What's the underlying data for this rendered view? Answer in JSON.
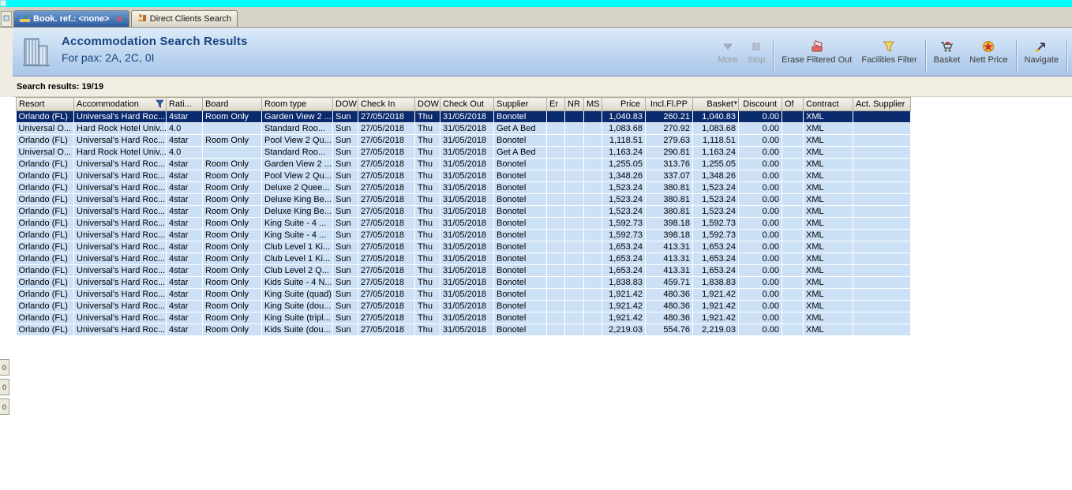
{
  "tabs": [
    {
      "label": "Book. ref.: <none>",
      "active": true,
      "icon": "beach-icon",
      "closable": true
    },
    {
      "label": "Direct Clients Search",
      "active": false,
      "icon": "clients-icon"
    }
  ],
  "header": {
    "title": "Accommodation Search Results",
    "subtitle": "For pax: 2A, 2C, 0I"
  },
  "toolbar": {
    "buttons": [
      {
        "label": "More",
        "icon": "more-icon",
        "disabled": true
      },
      {
        "label": "Stop",
        "icon": "stop-icon",
        "disabled": true
      },
      {
        "label": "Erase Filtered Out",
        "icon": "erase-filtered-out-icon",
        "disabled": false
      },
      {
        "label": "Facilities Filter",
        "icon": "facilities-filter-icon",
        "disabled": false
      },
      {
        "label": "Basket",
        "icon": "basket-icon",
        "disabled": false
      },
      {
        "label": "Nett Price",
        "icon": "nett-price-icon",
        "disabled": false
      },
      {
        "label": "Navigate",
        "icon": "navigate-icon",
        "disabled": false
      }
    ]
  },
  "results": {
    "summary": "Search results: 19/19"
  },
  "table": {
    "columns": [
      "Resort",
      "Accommodation",
      "Rati...",
      "Board",
      "Room type",
      "DOW",
      "Check In",
      "DOW",
      "Check Out",
      "Supplier",
      "Er",
      "NR",
      "MS",
      "Price",
      "Incl.Fl.PP",
      "Basket",
      "Discount",
      "Of",
      "Contract",
      "Act. Supplier"
    ],
    "selected_row_index": 0,
    "rows": [
      [
        "Orlando (FL)",
        "Universal's Hard Roc...",
        "4star",
        "Room Only",
        "Garden View 2 ...",
        "Sun",
        "27/05/2018",
        "Thu",
        "31/05/2018",
        "Bonotel",
        "",
        "",
        "",
        "1,040.83",
        "260.21",
        "1,040.83",
        "0.00",
        "",
        "XML",
        ""
      ],
      [
        "Universal O...",
        "Hard Rock Hotel Univ...",
        "4.0",
        "",
        "Standard Roo...",
        "Sun",
        "27/05/2018",
        "Thu",
        "31/05/2018",
        "Get A Bed",
        "",
        "",
        "",
        "1,083.68",
        "270.92",
        "1,083.68",
        "0.00",
        "",
        "XML",
        ""
      ],
      [
        "Orlando (FL)",
        "Universal's Hard Roc...",
        "4star",
        "Room Only",
        "Pool View 2 Qu...",
        "Sun",
        "27/05/2018",
        "Thu",
        "31/05/2018",
        "Bonotel",
        "",
        "",
        "",
        "1,118.51",
        "279.63",
        "1,118.51",
        "0.00",
        "",
        "XML",
        ""
      ],
      [
        "Universal O...",
        "Hard Rock Hotel Univ...",
        "4.0",
        "",
        "Standard Roo...",
        "Sun",
        "27/05/2018",
        "Thu",
        "31/05/2018",
        "Get A Bed",
        "",
        "",
        "",
        "1,163.24",
        "290.81",
        "1,163.24",
        "0.00",
        "",
        "XML",
        ""
      ],
      [
        "Orlando (FL)",
        "Universal's Hard Roc...",
        "4star",
        "Room Only",
        "Garden View 2 ...",
        "Sun",
        "27/05/2018",
        "Thu",
        "31/05/2018",
        "Bonotel",
        "",
        "",
        "",
        "1,255.05",
        "313.76",
        "1,255.05",
        "0.00",
        "",
        "XML",
        ""
      ],
      [
        "Orlando (FL)",
        "Universal's Hard Roc...",
        "4star",
        "Room Only",
        "Pool View 2 Qu...",
        "Sun",
        "27/05/2018",
        "Thu",
        "31/05/2018",
        "Bonotel",
        "",
        "",
        "",
        "1,348.26",
        "337.07",
        "1,348.26",
        "0.00",
        "",
        "XML",
        ""
      ],
      [
        "Orlando (FL)",
        "Universal's Hard Roc...",
        "4star",
        "Room Only",
        "Deluxe 2 Quee...",
        "Sun",
        "27/05/2018",
        "Thu",
        "31/05/2018",
        "Bonotel",
        "",
        "",
        "",
        "1,523.24",
        "380.81",
        "1,523.24",
        "0.00",
        "",
        "XML",
        ""
      ],
      [
        "Orlando (FL)",
        "Universal's Hard Roc...",
        "4star",
        "Room Only",
        "Deluxe King Be...",
        "Sun",
        "27/05/2018",
        "Thu",
        "31/05/2018",
        "Bonotel",
        "",
        "",
        "",
        "1,523.24",
        "380.81",
        "1,523.24",
        "0.00",
        "",
        "XML",
        ""
      ],
      [
        "Orlando (FL)",
        "Universal's Hard Roc...",
        "4star",
        "Room Only",
        "Deluxe King Be...",
        "Sun",
        "27/05/2018",
        "Thu",
        "31/05/2018",
        "Bonotel",
        "",
        "",
        "",
        "1,523.24",
        "380.81",
        "1,523.24",
        "0.00",
        "",
        "XML",
        ""
      ],
      [
        "Orlando (FL)",
        "Universal's Hard Roc...",
        "4star",
        "Room Only",
        "King Suite - 4 ...",
        "Sun",
        "27/05/2018",
        "Thu",
        "31/05/2018",
        "Bonotel",
        "",
        "",
        "",
        "1,592.73",
        "398.18",
        "1,592.73",
        "0.00",
        "",
        "XML",
        ""
      ],
      [
        "Orlando (FL)",
        "Universal's Hard Roc...",
        "4star",
        "Room Only",
        "King Suite - 4 ...",
        "Sun",
        "27/05/2018",
        "Thu",
        "31/05/2018",
        "Bonotel",
        "",
        "",
        "",
        "1,592.73",
        "398.18",
        "1,592.73",
        "0.00",
        "",
        "XML",
        ""
      ],
      [
        "Orlando (FL)",
        "Universal's Hard Roc...",
        "4star",
        "Room Only",
        "Club Level 1 Ki...",
        "Sun",
        "27/05/2018",
        "Thu",
        "31/05/2018",
        "Bonotel",
        "",
        "",
        "",
        "1,653.24",
        "413.31",
        "1,653.24",
        "0.00",
        "",
        "XML",
        ""
      ],
      [
        "Orlando (FL)",
        "Universal's Hard Roc...",
        "4star",
        "Room Only",
        "Club Level 1 Ki...",
        "Sun",
        "27/05/2018",
        "Thu",
        "31/05/2018",
        "Bonotel",
        "",
        "",
        "",
        "1,653.24",
        "413.31",
        "1,653.24",
        "0.00",
        "",
        "XML",
        ""
      ],
      [
        "Orlando (FL)",
        "Universal's Hard Roc...",
        "4star",
        "Room Only",
        "Club Level 2 Q...",
        "Sun",
        "27/05/2018",
        "Thu",
        "31/05/2018",
        "Bonotel",
        "",
        "",
        "",
        "1,653.24",
        "413.31",
        "1,653.24",
        "0.00",
        "",
        "XML",
        ""
      ],
      [
        "Orlando (FL)",
        "Universal's Hard Roc...",
        "4star",
        "Room Only",
        "Kids Suite - 4 N...",
        "Sun",
        "27/05/2018",
        "Thu",
        "31/05/2018",
        "Bonotel",
        "",
        "",
        "",
        "1,838.83",
        "459.71",
        "1,838.83",
        "0.00",
        "",
        "XML",
        ""
      ],
      [
        "Orlando (FL)",
        "Universal's Hard Roc...",
        "4star",
        "Room Only",
        "King Suite (quad)",
        "Sun",
        "27/05/2018",
        "Thu",
        "31/05/2018",
        "Bonotel",
        "",
        "",
        "",
        "1,921.42",
        "480.36",
        "1,921.42",
        "0.00",
        "",
        "XML",
        ""
      ],
      [
        "Orlando (FL)",
        "Universal's Hard Roc...",
        "4star",
        "Room Only",
        "King Suite (dou...",
        "Sun",
        "27/05/2018",
        "Thu",
        "31/05/2018",
        "Bonotel",
        "",
        "",
        "",
        "1,921.42",
        "480.36",
        "1,921.42",
        "0.00",
        "",
        "XML",
        ""
      ],
      [
        "Orlando (FL)",
        "Universal's Hard Roc...",
        "4star",
        "Room Only",
        "King Suite (tripl...",
        "Sun",
        "27/05/2018",
        "Thu",
        "31/05/2018",
        "Bonotel",
        "",
        "",
        "",
        "1,921.42",
        "480.36",
        "1,921.42",
        "0.00",
        "",
        "XML",
        ""
      ],
      [
        "Orlando (FL)",
        "Universal's Hard Roc...",
        "4star",
        "Room Only",
        "Kids Suite (dou...",
        "Sun",
        "27/05/2018",
        "Thu",
        "31/05/2018",
        "Bonotel",
        "",
        "",
        "",
        "2,219.03",
        "554.76",
        "2,219.03",
        "0.00",
        "",
        "XML",
        ""
      ]
    ]
  },
  "side_tabs": [
    "0",
    "0",
    "0"
  ]
}
